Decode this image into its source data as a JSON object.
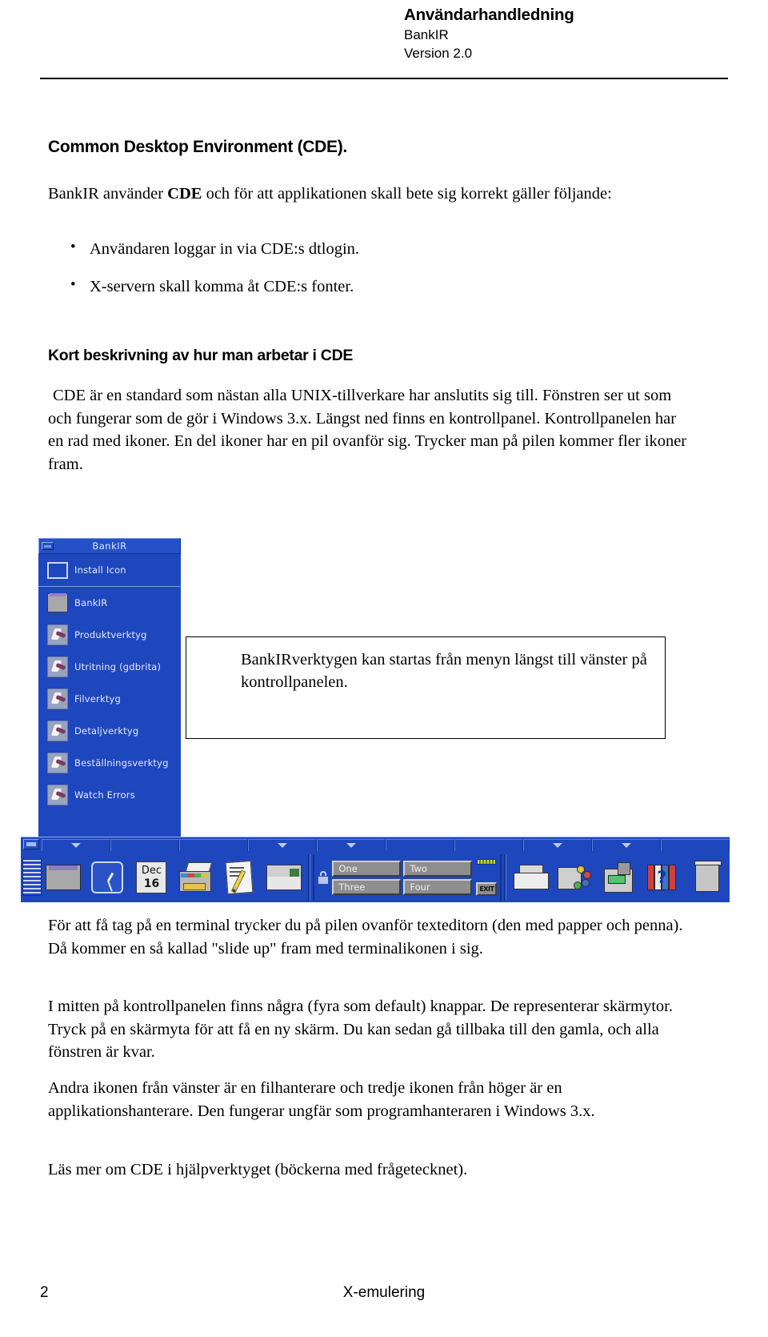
{
  "header": {
    "title": "Användarhandledning",
    "product": "BankIR",
    "version": "Version 2.0"
  },
  "section": {
    "heading": "Common Desktop Environment (CDE).",
    "intro_pre": "BankIR använder ",
    "intro_bold": "CDE",
    "intro_post": " och för att applikationen skall bete sig korrekt gäller följande:",
    "bullets": [
      "Användaren loggar in via CDE:s dtlogin.",
      "X-servern skall komma åt CDE:s fonter."
    ],
    "subheading": "Kort beskrivning av hur man arbetar i CDE",
    "paragraph": "CDE är en standard som nästan alla UNIX-tillverkare har anslutits sig till. Fönstren ser ut som och fungerar som de gör i Windows 3.x. Längst ned finns en kontrollpanel. Kontrollpanelen har en rad med ikoner. En del ikoner har en pil ovanför sig. Trycker man på pilen kommer fler ikoner fram."
  },
  "callout": {
    "text": "BankIRverktygen kan startas från menyn längst till vänster på kontrollpanelen."
  },
  "cde": {
    "menu": {
      "title": "BankIR",
      "install_item": "Install Icon",
      "items": [
        {
          "label": "BankIR",
          "icon": "folder-icon"
        },
        {
          "label": "Produktverktyg",
          "icon": "runner-icon"
        },
        {
          "label": "Utritning (gdbrita)",
          "icon": "runner-icon"
        },
        {
          "label": "Filverktyg",
          "icon": "runner-icon"
        },
        {
          "label": "Detaljverktyg",
          "icon": "runner-icon"
        },
        {
          "label": "Beställningsverktyg",
          "icon": "runner-icon"
        },
        {
          "label": "Watch Errors",
          "icon": "runner-icon"
        }
      ]
    },
    "panel": {
      "calendar_month": "Dec",
      "calendar_day": "16",
      "exit_label": "EXIT",
      "help_glyph": "?",
      "workspaces": [
        "One",
        "Two",
        "Three",
        "Four"
      ],
      "icon_names": [
        "file-manager-folder-icon",
        "clock-icon",
        "calendar-icon",
        "file-manager-icon",
        "text-editor-icon",
        "mailer-icon",
        "printer-icon",
        "style-manager-icon",
        "application-manager-icon",
        "help-manager-icon",
        "trash-icon"
      ]
    }
  },
  "body_text": {
    "p1": "För att få tag på en terminal trycker du på pilen ovanför texteditorn (den med papper och penna). Då kommer en så kallad \"slide up\" fram med terminalikonen i sig.",
    "p2": "I mitten på kontrollpanelen finns några (fyra som default) knappar. De representerar skärmytor. Tryck på en skärmyta för att få en ny skärm. Du kan sedan gå tillbaka till den gamla, och alla fönstren är kvar.",
    "p3": "Andra ikonen från vänster är en filhanterare och tredje ikonen från höger är en applikationshanterare. Den fungerar ungfär som programhanteraren i Windows 3.x.",
    "p4": "Läs mer om CDE i hjälpverktyget (böckerna med frågetecknet)."
  },
  "footer": {
    "page_number": "2",
    "center_label": "X-emulering"
  },
  "colors": {
    "cde_blue": "#1e47bd",
    "cde_blue_light": "#2450c9",
    "panel_text": "#e4eaf9",
    "button_grey": "#8e8e8e"
  }
}
